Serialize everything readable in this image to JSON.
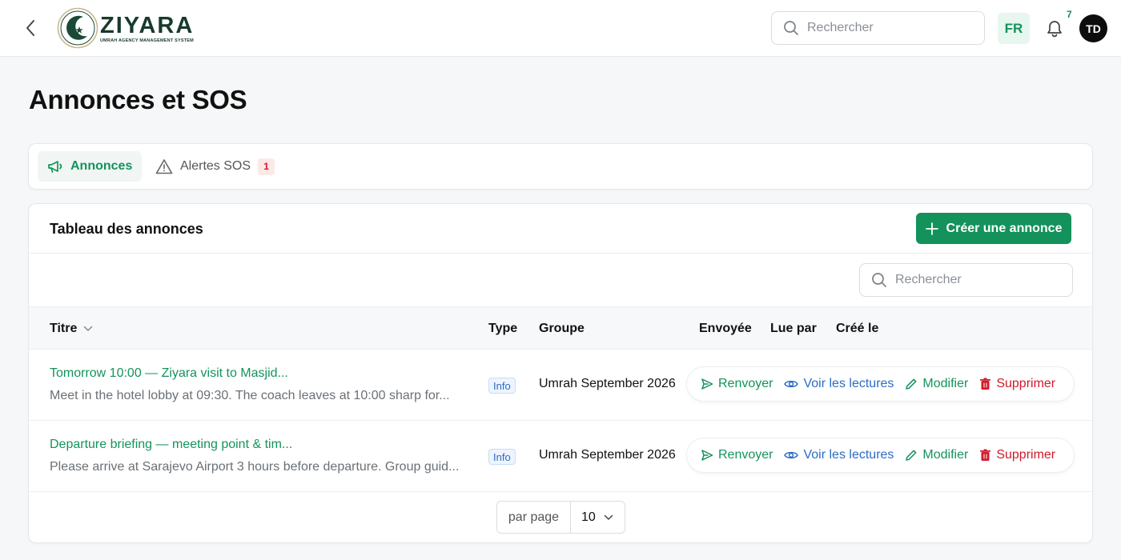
{
  "header": {
    "logo_name": "ZIYARA",
    "logo_subtitle": "UMRAH AGENCY MANAGEMENT SYSTEM",
    "search_placeholder": "Rechercher",
    "language": "FR",
    "notification_count": "7",
    "avatar_initials": "TD"
  },
  "page": {
    "title": "Annonces et SOS"
  },
  "tabs": [
    {
      "label": "Annonces",
      "active": true,
      "icon": "megaphone-icon"
    },
    {
      "label": "Alertes SOS",
      "active": false,
      "icon": "warning-icon",
      "badge": "1"
    }
  ],
  "table_card": {
    "title": "Tableau des annonces",
    "create_label": "Créer une annonce",
    "search_placeholder": "Rechercher",
    "columns": {
      "title": "Titre",
      "type": "Type",
      "group": "Groupe",
      "sent": "Envoyée",
      "read_by": "Lue par",
      "created": "Créé le"
    },
    "rows": [
      {
        "title": "Tomorrow 10:00 — Ziyara visit to Masjid...",
        "body": "Meet in the hotel lobby at 09:30. The coach leaves at 10:00 sharp for...",
        "type": "Info",
        "group": "Umrah September 2026"
      },
      {
        "title": "Departure briefing — meeting point & tim...",
        "body": "Please arrive at Sarajevo Airport 3 hours before departure. Group guid...",
        "type": "Info",
        "group": "Umrah September 2026"
      }
    ],
    "actions": {
      "resend": "Renvoyer",
      "view_reads": "Voir les lectures",
      "edit": "Modifier",
      "delete": "Supprimer"
    },
    "pagination": {
      "per_page_label": "par page",
      "per_page_value": "10"
    }
  },
  "colors": {
    "brand_green": "#13925b",
    "link_blue": "#2b6cc4",
    "danger_red": "#d11a2a"
  }
}
